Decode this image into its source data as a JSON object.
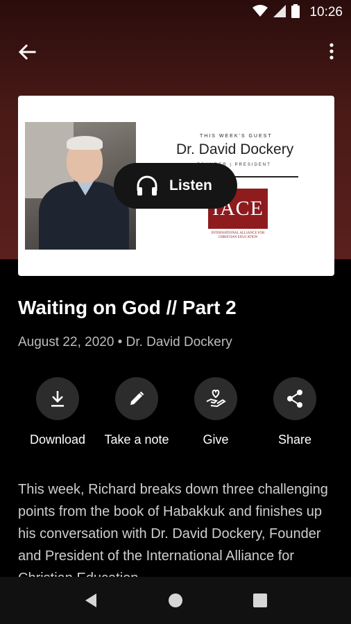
{
  "status_bar": {
    "time": "10:26",
    "icons": [
      "wifi-icon",
      "signal-icon",
      "battery-icon"
    ]
  },
  "app_bar": {
    "back_icon": "arrow-back-icon",
    "menu_icon": "more-vert-icon"
  },
  "artwork": {
    "kicker": "THIS WEEK'S GUEST",
    "guest_name": "Dr. David Dockery",
    "guest_role": "FOUNDER | PRESIDENT",
    "logo_text": "IACE",
    "logo_subtitle": "INTERNATIONAL ALLIANCE FOR CHRISTIAN EDUCATION"
  },
  "listen_button": {
    "label": "Listen",
    "icon": "headphones-icon"
  },
  "episode": {
    "title": "Waiting on God // Part 2",
    "meta": "August 22, 2020 • Dr. David Dockery",
    "description": "This week, Richard breaks down three challenging points from the book of Habakkuk and finishes up his conversation with Dr. David Dockery, Founder and President of the International Alliance for Christian Education."
  },
  "actions": [
    {
      "label": "Download",
      "icon": "download-icon"
    },
    {
      "label": "Take a note",
      "icon": "pencil-icon"
    },
    {
      "label": "Give",
      "icon": "give-hand-heart-icon"
    },
    {
      "label": "Share",
      "icon": "share-icon"
    }
  ],
  "nav_bar": {
    "icons": [
      "nav-back-icon",
      "nav-home-icon",
      "nav-recents-icon"
    ]
  },
  "colors": {
    "hero_gradient_top": "#2a0d0c",
    "hero_gradient_bottom": "#5a201c",
    "background": "#000000",
    "action_circle": "#2c2c2c",
    "logo_red": "#8e1b1e"
  }
}
